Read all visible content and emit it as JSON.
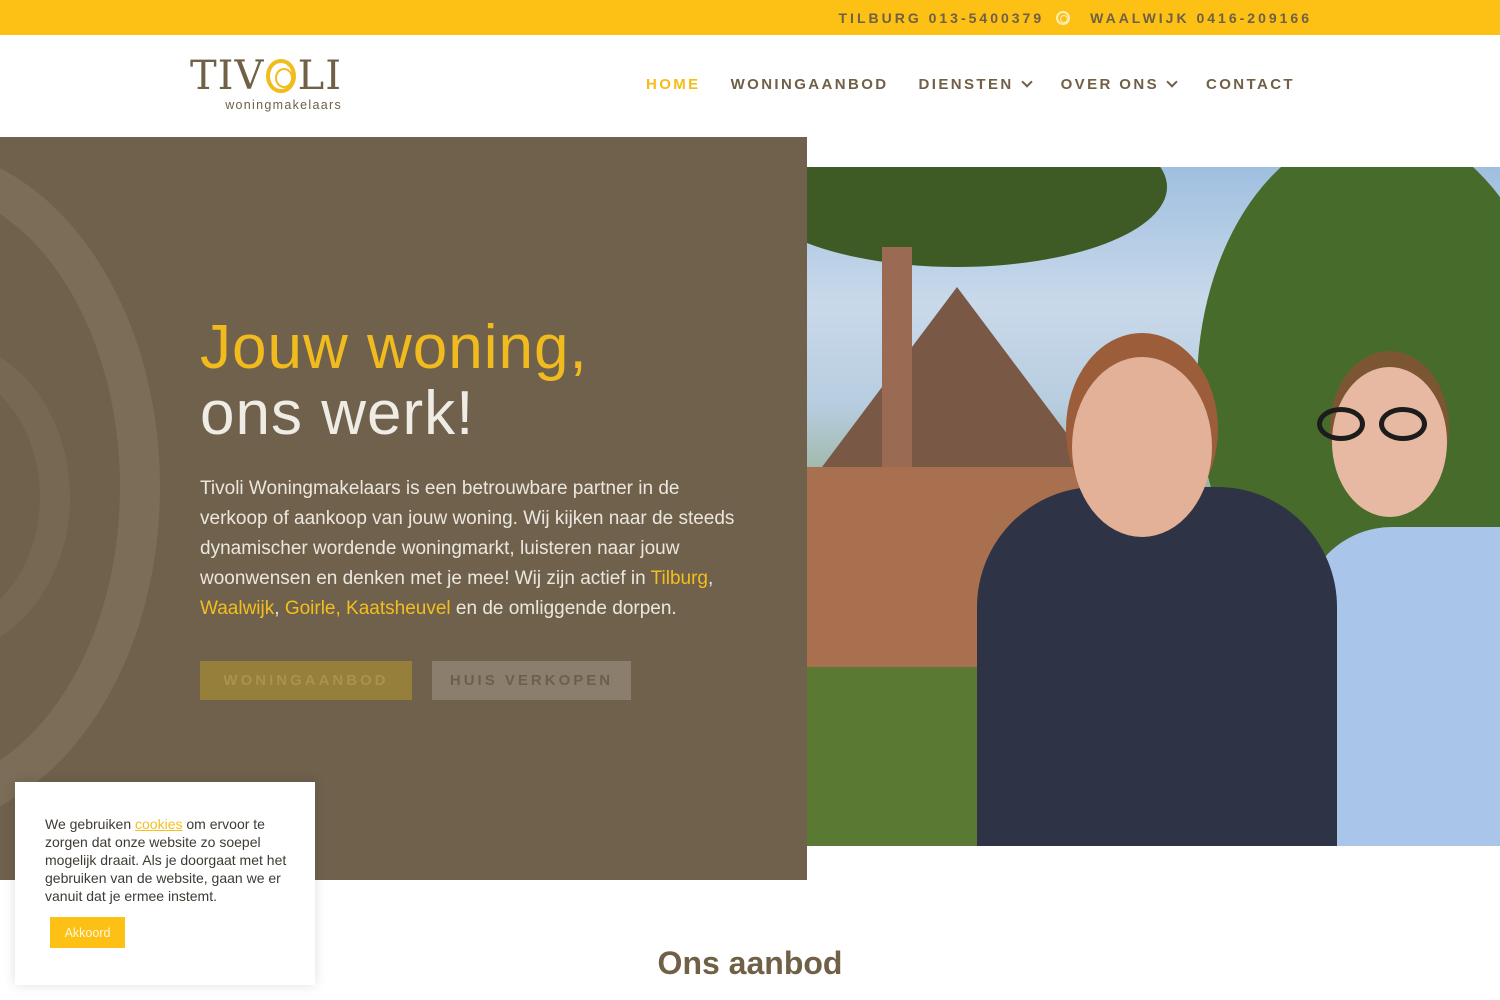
{
  "topbar": {
    "phone_tilburg": "TILBURG 013-5400379",
    "phone_waalwijk": "WAALWIJK 0416-209166",
    "separator_icon": "sun-circle-icon"
  },
  "logo": {
    "letters_before": "TIV",
    "letters_after": "LI",
    "subtitle": "woningmakelaars"
  },
  "nav": {
    "items": [
      {
        "label": "HOME",
        "active": true
      },
      {
        "label": "WONINGAANBOD"
      },
      {
        "label": "DIENSTEN",
        "has_dropdown": true
      },
      {
        "label": "OVER ONS",
        "has_dropdown": true
      },
      {
        "label": "CONTACT"
      }
    ]
  },
  "hero": {
    "title_line1": "Jouw woning,",
    "title_line2": "ons werk!",
    "text_before": "Tivoli Woningmakelaars is een betrouwbare partner in de verkoop of aankoop van jouw woning. Wij kijken naar de steeds dynamischer wordende woningmarkt, luisteren naar jouw woonwensen en denken met je mee! Wij zijn actief in ",
    "link_tilburg": "Tilburg",
    "comma1": ", ",
    "link_waalwijk": "Waalwijk",
    "comma2": ", ",
    "link_goirle_kaatsheuvel": "Goirle, Kaatsheuvel",
    "text_after": " en de omliggende dorpen.",
    "button_primary": "WONINGAANBOD",
    "button_secondary": "HUIS VERKOPEN",
    "photo_alt": "Two real estate agents in front of a brick house"
  },
  "cookie": {
    "text_before": "We gebruiken ",
    "link": "cookies",
    "text_after": " om ervoor te zorgen dat onze website zo soepel mogelijk draait. Als je doorgaat met het gebruiken van de website, gaan we er vanuit dat je ermee instemt.",
    "button": "Akkoord"
  },
  "section": {
    "title": "Ons aanbod"
  },
  "colors": {
    "accent_yellow": "#fdc015",
    "brand_brown": "#6f6046",
    "hero_bg": "#6f614c"
  }
}
